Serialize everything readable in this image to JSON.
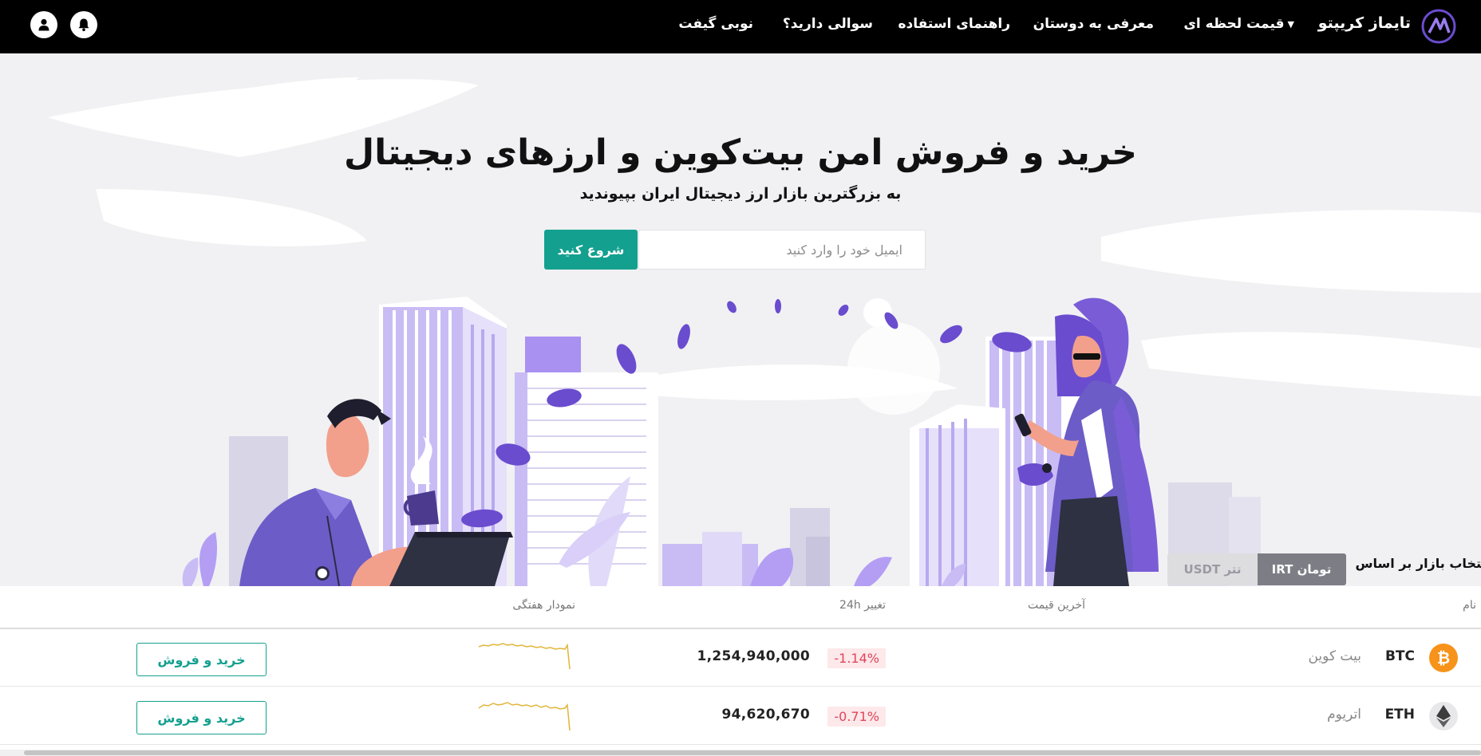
{
  "nav": {
    "brand": "تایماز کریپتو",
    "menu": [
      {
        "label": "قیمت لحظه ای"
      },
      {
        "label": "معرفی به دوستان"
      },
      {
        "label": "راهنمای استفاده"
      },
      {
        "label": "سوالی دارید؟"
      },
      {
        "label": "نوبی گیفت"
      }
    ],
    "icons": [
      "logo-icon",
      "bell-icon",
      "user-icon"
    ]
  },
  "hero": {
    "title": "خرید و فروش امن بیت‌کوین و ارزهای دیجیتال",
    "subtitle": "به بزرگترین بازار ارز دیجیتال ایران بپیوندید",
    "email_placeholder": "ایمیل خود را وارد کنید",
    "start_label": "شروع کنید"
  },
  "market": {
    "label": "انتخاب بازار بر اساس",
    "irt_label": "تومان IRT",
    "usdt_label": "تتر USDT",
    "selected": "IRT"
  },
  "table": {
    "headers": {
      "name": "نام",
      "price": "آخرین قیمت",
      "change": "تغییر 24h",
      "chart": "نمودار هفتگی"
    },
    "rows": [
      {
        "symbol": "BTC",
        "name": "بیت کوین",
        "price": "1,254,940,000",
        "change": "-1.14%",
        "action": "خرید و فروش",
        "icon": "bitcoin-icon"
      },
      {
        "symbol": "ETH",
        "name": "اتریوم",
        "price": "94,620,670",
        "change": "-0.71%",
        "action": "خرید و فروش",
        "icon": "ethereum-icon"
      }
    ]
  },
  "colors": {
    "accent": "#14a08f",
    "purple": "#7b5cd6",
    "negative": "#e0455a",
    "sparkline": "#e2b53b",
    "btc": "#f7931a"
  }
}
